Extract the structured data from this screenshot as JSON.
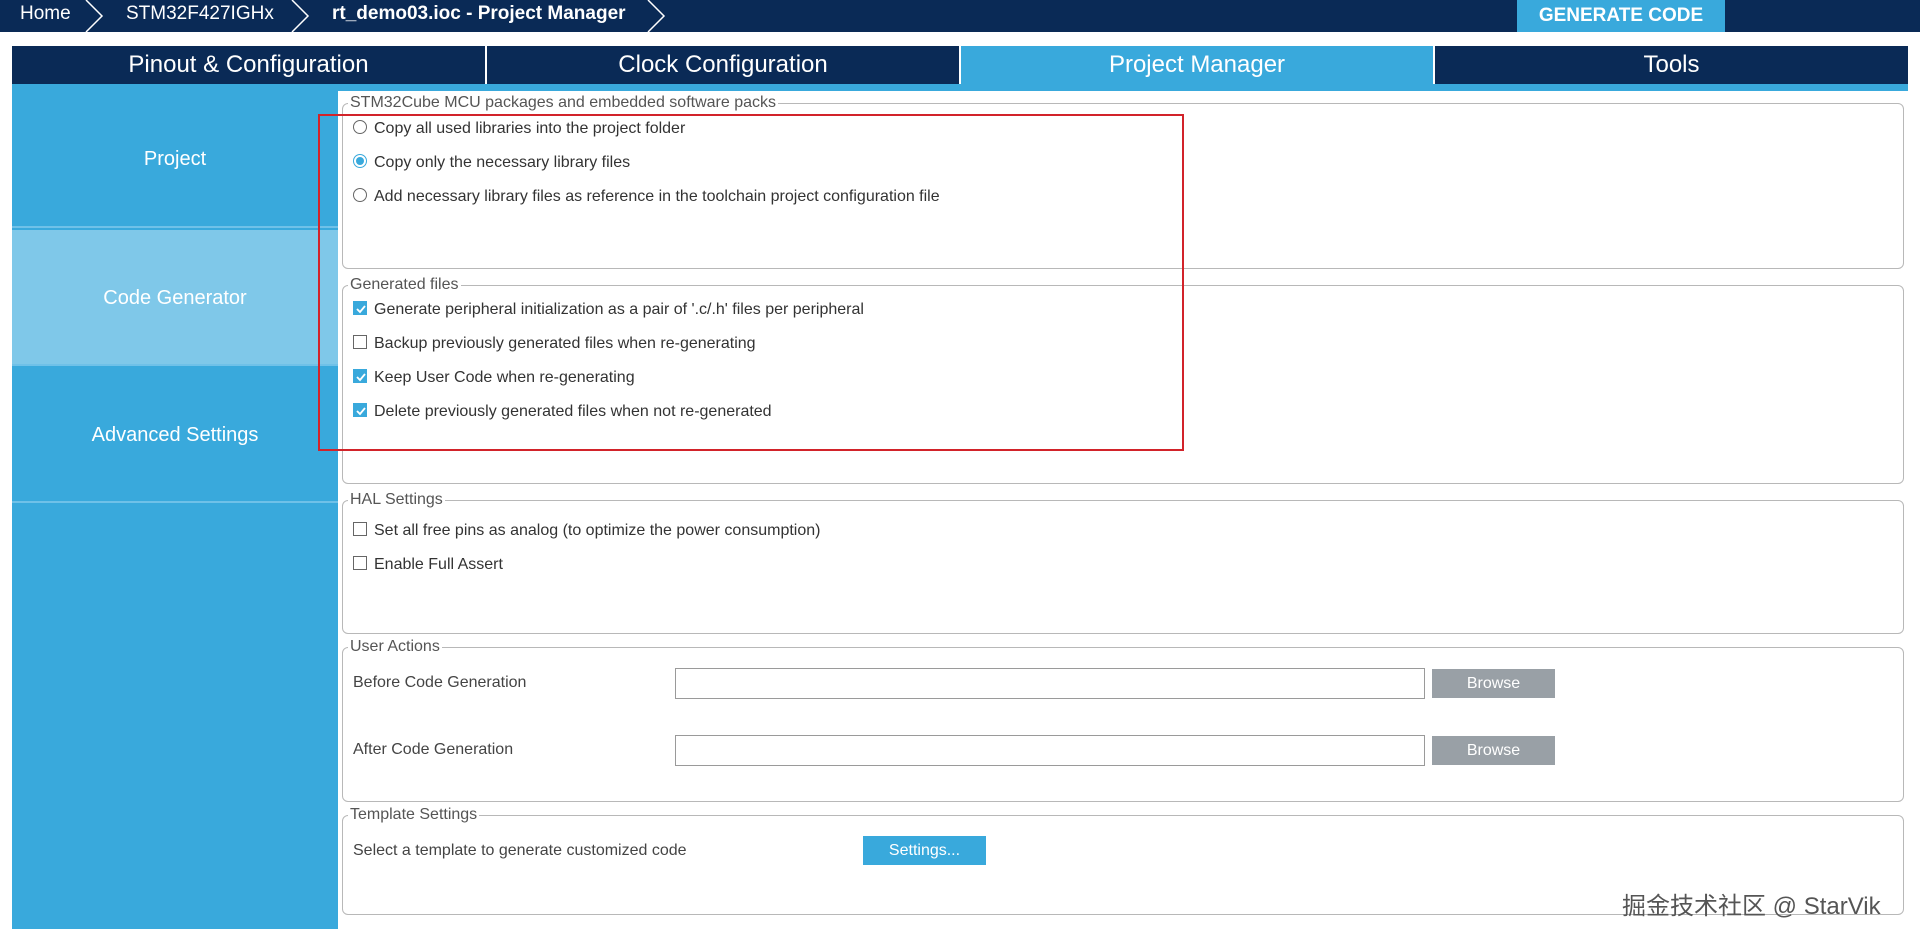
{
  "breadcrumb": {
    "home": "Home",
    "device": "STM32F427IGHx",
    "project": "rt_demo03.ioc - Project Manager"
  },
  "generate_button": "GENERATE CODE",
  "tabs": [
    {
      "label": "Pinout & Configuration",
      "active": false
    },
    {
      "label": "Clock Configuration",
      "active": false
    },
    {
      "label": "Project Manager",
      "active": true
    },
    {
      "label": "Tools",
      "active": false
    }
  ],
  "sidebar": {
    "items": [
      {
        "label": "Project",
        "active": false
      },
      {
        "label": "Code Generator",
        "active": true
      },
      {
        "label": "Advanced Settings",
        "active": false
      }
    ]
  },
  "packages": {
    "legend": "STM32Cube MCU packages and embedded software packs",
    "options": [
      {
        "label": "Copy all used libraries into the project folder",
        "selected": false
      },
      {
        "label": "Copy only the necessary library files",
        "selected": true
      },
      {
        "label": "Add necessary library files as reference in the toolchain project configuration file",
        "selected": false
      }
    ]
  },
  "generated_files": {
    "legend": "Generated files",
    "options": [
      {
        "label": "Generate peripheral initialization as a pair of '.c/.h' files per peripheral",
        "checked": true
      },
      {
        "label": "Backup previously generated files when re-generating",
        "checked": false
      },
      {
        "label": "Keep User Code when re-generating",
        "checked": true
      },
      {
        "label": "Delete previously generated files when not re-generated",
        "checked": true
      }
    ]
  },
  "hal_settings": {
    "legend": "HAL Settings",
    "options": [
      {
        "label": "Set all free pins as analog (to optimize the power consumption)",
        "checked": false
      },
      {
        "label": "Enable Full Assert",
        "checked": false
      }
    ]
  },
  "user_actions": {
    "legend": "User Actions",
    "before_label": "Before Code Generation",
    "before_value": "",
    "after_label": "After Code Generation",
    "after_value": "",
    "browse_label": "Browse"
  },
  "template_settings": {
    "legend": "Template Settings",
    "description": "Select a template to generate customized code",
    "button_label": "Settings..."
  },
  "watermark": "掘金技术社区 @ StarVik",
  "colors": {
    "navy": "#0a2a56",
    "accent": "#39a9dc",
    "active_side": "#7fc8e9",
    "highlight": "#d2232a"
  }
}
